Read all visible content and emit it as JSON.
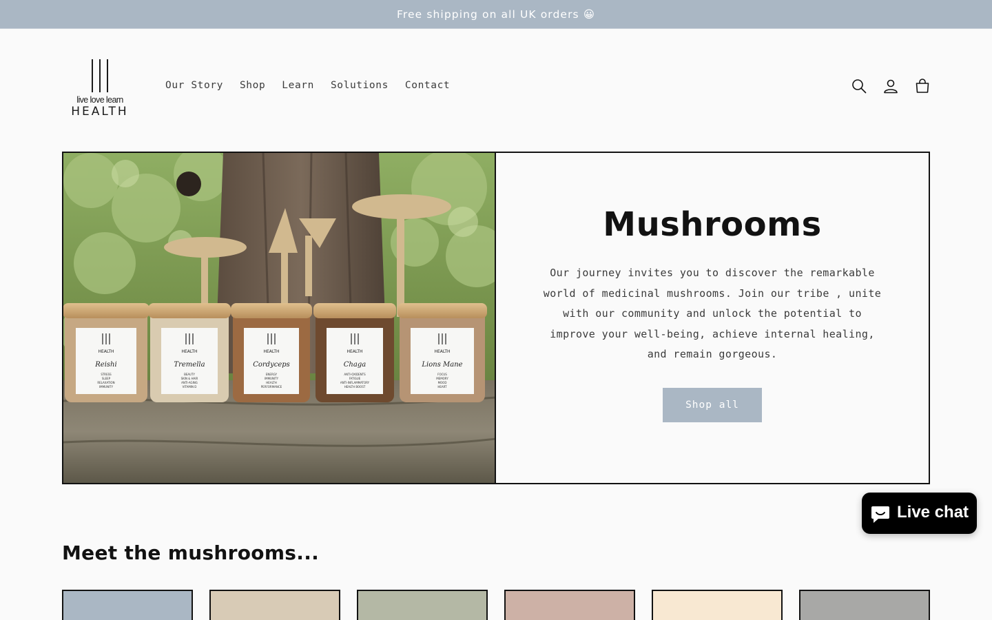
{
  "announcement": {
    "text": "Free shipping on all UK orders 😀"
  },
  "header": {
    "logo": {
      "tagline": "live love learn",
      "wordmark": "HEALTH"
    },
    "nav": [
      {
        "label": "Our Story"
      },
      {
        "label": "Shop"
      },
      {
        "label": "Learn"
      },
      {
        "label": "Solutions"
      },
      {
        "label": "Contact"
      }
    ],
    "icons": [
      "search-icon",
      "account-icon",
      "cart-icon"
    ]
  },
  "hero": {
    "title": "Mushrooms",
    "text": "Our journey invites you to discover the remarkable world of medicinal mushrooms. Join our tribe , unite with our community and unlock the potential to improve your well-being, achieve internal healing, and remain gorgeous.",
    "button_label": "Shop all",
    "image": {
      "jars": [
        {
          "name": "Reishi",
          "benefits": [
            "STRESS",
            "SLEEP",
            "RELAXATION",
            "IMMUNITY"
          ]
        },
        {
          "name": "Tremella",
          "benefits": [
            "BEAUTY",
            "SKIN & HAIR",
            "ANTI-AGING",
            "VITAMIN D"
          ]
        },
        {
          "name": "Cordyceps",
          "benefits": [
            "ENERGY",
            "IMMUNITY",
            "HEALTH",
            "PERFORMANCE"
          ]
        },
        {
          "name": "Chaga",
          "benefits": [
            "ANTI-OXIDENTS",
            "FATIGUE",
            "ANTI-INFLAMMATORY",
            "HEALTH BOOST"
          ]
        },
        {
          "name": "Lions Mane",
          "benefits": [
            "FOCUS",
            "MEMORY",
            "MOOD",
            "HEART"
          ]
        }
      ]
    }
  },
  "collection": {
    "title": "Meet the mushrooms...",
    "cards": [
      {
        "color": "#aab7c4"
      },
      {
        "color": "#d8cbb6"
      },
      {
        "color": "#b4b8a5"
      },
      {
        "color": "#cdb1a6"
      },
      {
        "color": "#f8e8d2"
      },
      {
        "color": "#a8a8a6"
      }
    ]
  },
  "chat": {
    "label": "Live chat"
  },
  "colors": {
    "accent": "#aab7c4",
    "text": "#121212",
    "background": "#fafafa"
  }
}
